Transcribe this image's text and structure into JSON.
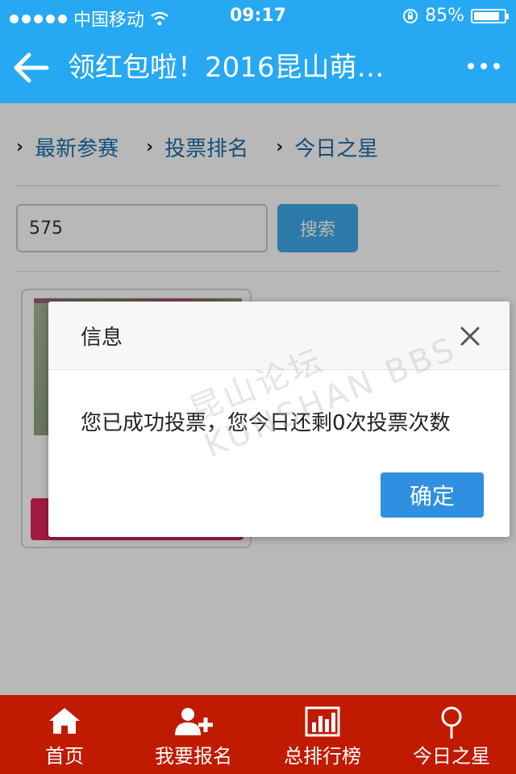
{
  "status_bar": {
    "carrier": "中国移动",
    "time": "09:17",
    "battery_percent": "85%",
    "battery_level": 0.85
  },
  "nav": {
    "title": "领红包啦！2016昆山萌…"
  },
  "tabs": [
    {
      "label": "最新参赛"
    },
    {
      "label": "投票排名"
    },
    {
      "label": "今日之星"
    }
  ],
  "search": {
    "value": "575",
    "button_label": "搜索"
  },
  "dialog": {
    "title": "信息",
    "message": "您已成功投票，您今日还剩0次投票次数",
    "confirm_label": "确定",
    "watermark": "昆山论坛 KUNSHAN BBS"
  },
  "bottom_nav": [
    {
      "label": "首页",
      "icon": "home-icon"
    },
    {
      "label": "我要报名",
      "icon": "user-add-icon"
    },
    {
      "label": "总排行榜",
      "icon": "bar-chart-icon"
    },
    {
      "label": "今日之星",
      "icon": "star-pin-icon"
    }
  ],
  "colors": {
    "header": "#26a8f2",
    "bottom_bar": "#c01a00",
    "confirm_button": "#2f8fe0",
    "vote_button": "#e0245f"
  }
}
